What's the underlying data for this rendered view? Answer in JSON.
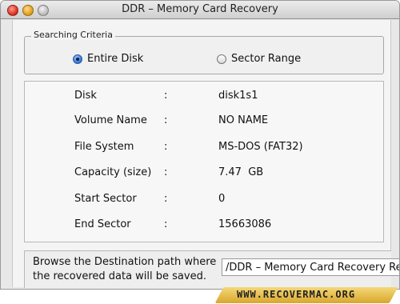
{
  "window": {
    "title": "DDR – Memory Card Recovery"
  },
  "criteria": {
    "label": "Searching Criteria",
    "options": [
      {
        "label": "Entire Disk",
        "selected": true
      },
      {
        "label": "Sector Range",
        "selected": false
      }
    ]
  },
  "info": {
    "rows": [
      {
        "label": "Disk",
        "sep": ":",
        "value": "disk1s1"
      },
      {
        "label": "Volume Name",
        "sep": ":",
        "value": "NO NAME"
      },
      {
        "label": "File System",
        "sep": ":",
        "value": "MS-DOS (FAT32)"
      },
      {
        "label": "Capacity (size)",
        "sep": ":",
        "value": "7.47  GB"
      },
      {
        "label": "Start Sector",
        "sep": ":",
        "value": "0"
      },
      {
        "label": "End Sector",
        "sep": ":",
        "value": "15663086"
      }
    ]
  },
  "browse": {
    "text": "Browse the Destination path where the recovered data will be saved.",
    "path_value": "/DDR – Memory Card Recovery Re"
  },
  "footer": {
    "site": "WWW.RECOVERMAC.ORG"
  }
}
